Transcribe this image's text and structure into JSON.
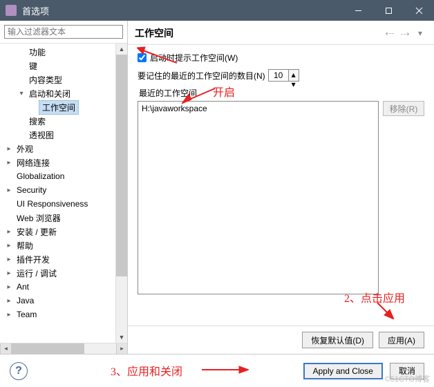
{
  "window": {
    "title": "首选项",
    "min_icon": "minimize",
    "max_icon": "maximize",
    "close_icon": "close"
  },
  "sidebar": {
    "filter_placeholder": "输入过滤器文本",
    "items": [
      {
        "label": "功能",
        "level": 1,
        "arrow": ""
      },
      {
        "label": "键",
        "level": 1,
        "arrow": ""
      },
      {
        "label": "内容类型",
        "level": 1,
        "arrow": ""
      },
      {
        "label": "启动和关闭",
        "level": 1,
        "arrow": "▾"
      },
      {
        "label": "工作空间",
        "level": 2,
        "arrow": "",
        "selected": true
      },
      {
        "label": "搜索",
        "level": 1,
        "arrow": ""
      },
      {
        "label": "透视图",
        "level": 1,
        "arrow": ""
      },
      {
        "label": "外观",
        "level": 0,
        "arrow": "▸"
      },
      {
        "label": "网络连接",
        "level": 0,
        "arrow": "▸"
      },
      {
        "label": "Globalization",
        "level": 0,
        "arrow": ""
      },
      {
        "label": "Security",
        "level": 0,
        "arrow": "▸"
      },
      {
        "label": "UI Responsiveness",
        "level": 0,
        "arrow": ""
      },
      {
        "label": "Web 浏览器",
        "level": 0,
        "arrow": ""
      },
      {
        "label": "安装 / 更新",
        "level": 0,
        "arrow": "▸"
      },
      {
        "label": "帮助",
        "level": 0,
        "arrow": "▸"
      },
      {
        "label": "插件开发",
        "level": 0,
        "arrow": "▸"
      },
      {
        "label": "运行 / 调试",
        "level": 0,
        "arrow": "▸"
      },
      {
        "label": "Ant",
        "level": 0,
        "arrow": "▸"
      },
      {
        "label": "Java",
        "level": 0,
        "arrow": "▸"
      },
      {
        "label": "Team",
        "level": 0,
        "arrow": "▸"
      }
    ]
  },
  "main": {
    "title": "工作空间",
    "checkbox_label": "启动时提示工作空间(W)",
    "checkbox_checked": true,
    "count_label": "要记住的最近的工作空间的数目(N)",
    "count_value": "10",
    "recent_label": "最近的工作空间",
    "recent_items": [
      "H:\\javaworkspace"
    ],
    "remove_btn": "移除(R)",
    "restore_btn": "恢复默认值(D)",
    "apply_btn": "应用(A)"
  },
  "footer": {
    "apply_close": "Apply and Close",
    "cancel": "取消"
  },
  "annotations": {
    "a1": "开启",
    "a2": "2、点击应用",
    "a3": "3、应用和关闭"
  },
  "watermark": "©51CTO博客"
}
